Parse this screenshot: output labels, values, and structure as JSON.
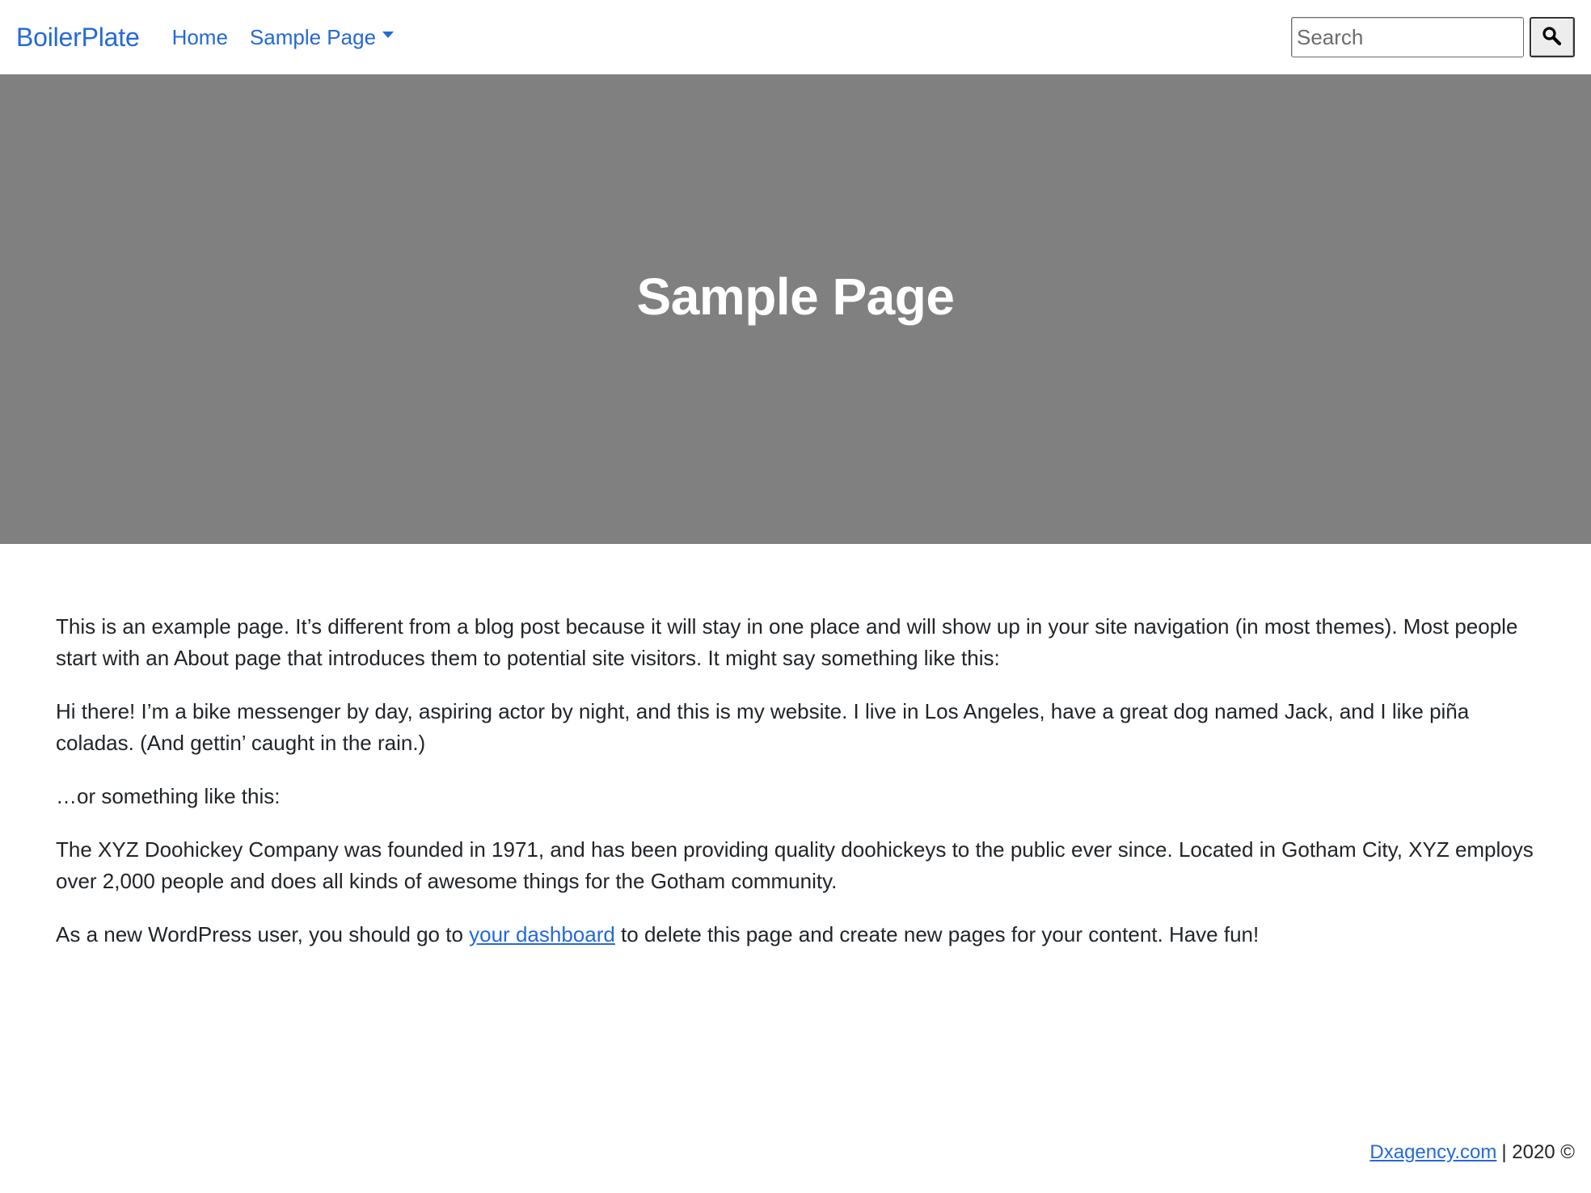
{
  "navbar": {
    "brand": "BoilerPlate",
    "links": [
      {
        "label": "Home"
      },
      {
        "label": "Sample Page"
      }
    ],
    "search": {
      "placeholder": "Search"
    },
    "search_button_icon": "magnifier-icon"
  },
  "hero": {
    "title": "Sample Page"
  },
  "content": {
    "paragraphs": [
      "This is an example page. It’s different from a blog post because it will stay in one place and will show up in your site navigation (in most themes). Most people start with an About page that introduces them to potential site visitors. It might say something like this:",
      "Hi there! I’m a bike messenger by day, aspiring actor by night, and this is my website. I live in Los Angeles, have a great dog named Jack, and I like piña coladas. (And gettin’ caught in the rain.)",
      "…or something like this:",
      "The XYZ Doohickey Company was founded in 1971, and has been providing quality doohickeys to the public ever since. Located in Gotham City, XYZ employs over 2,000 people and does all kinds of awesome things for the Gotham community."
    ],
    "last_paragraph": {
      "before_link": "As a new WordPress user, you should go to ",
      "link_text": "your dashboard",
      "after_link": " to delete this page and create new pages for your content. Have fun!"
    }
  },
  "footer": {
    "link_text": "Dxagency.com",
    "text": "| 2020 ©"
  },
  "colors": {
    "link": "#2469d6",
    "hero_bg": "#808080",
    "hero_text": "#ffffff",
    "body_text": "#212529"
  }
}
